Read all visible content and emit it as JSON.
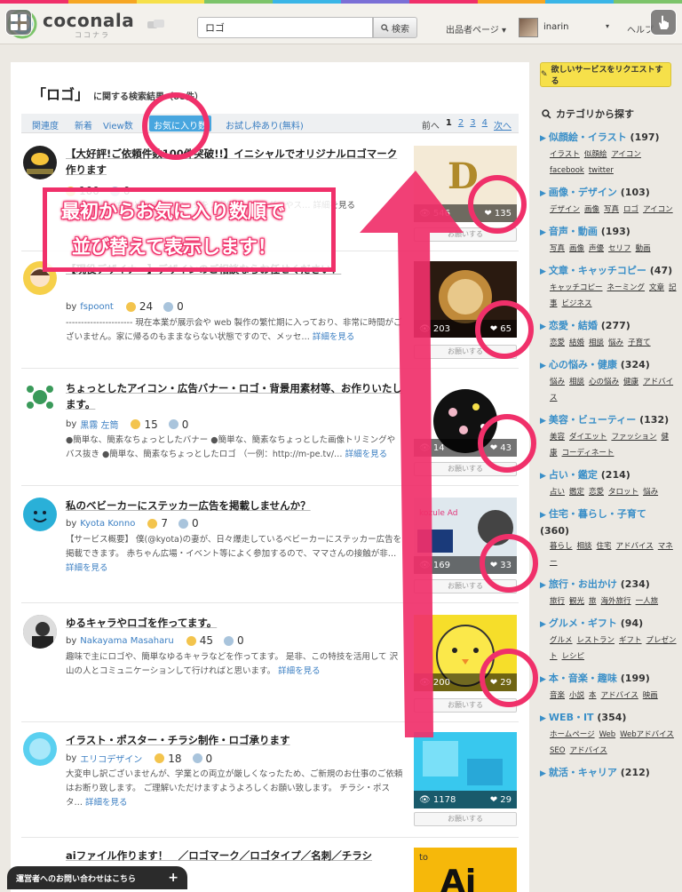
{
  "colors": {
    "accent": "#f0306a",
    "link": "#3a7ec2",
    "category": "#3a8fc8",
    "active_sort": "#48a6df"
  },
  "strip_colors": [
    "#f0306a",
    "#f6a623",
    "#f6e04a",
    "#7cc46a",
    "#3ab5e6",
    "#7a6fd6",
    "#f0306a",
    "#f6a623",
    "#3ab5e6",
    "#7cc46a"
  ],
  "header": {
    "logo": "coconala",
    "logo_sub": "ココナラ",
    "search_value": "ロゴ",
    "search_button": "検索",
    "seller_page": "出品者ページ",
    "user_name": "inarin",
    "help": "ヘルプ"
  },
  "results": {
    "query_title": "「ロゴ」",
    "suffix": "に関する検索結果（68件）"
  },
  "sort": {
    "items": [
      "関連度",
      "新着",
      "View数",
      "お気に入り数",
      "お試し枠あり(無料)"
    ],
    "active": "お気に入り数"
  },
  "pager": {
    "prev": "前へ",
    "pages": [
      "1",
      "2",
      "3",
      "4"
    ],
    "current": "1",
    "next": "次へ"
  },
  "items": [
    {
      "title": "【大好評!ご依頼件数100件突破!!】イニシャルでオリジナルロゴマーク作ります",
      "seller": "",
      "good": "100",
      "bad": "0",
      "desc": "…（王子様／女など）のイ…マークを２案作り…ケーダイやス… 詳細を見る",
      "more": "詳細を見る",
      "views": "546",
      "favs": "135",
      "button": "お願いする"
    },
    {
      "title": "【現役デザイナー】デザインのご相談ならお任せください！",
      "seller": "fspoont",
      "good": "24",
      "bad": "0",
      "desc": "---------------------- 現在本業が展示会や web 製作の繁忙期に入っており、非常に時間がございません。家に帰るのもままならない状態ですので、メッセ…",
      "more": "詳細を見る",
      "views": "203",
      "favs": "65",
      "button": "お願いする"
    },
    {
      "title": "ちょっとしたアイコン・広告バナー・ロゴ・背景用素材等、お作りいたします。",
      "seller": "黒霧 左筒",
      "good": "15",
      "bad": "0",
      "desc": "●簡単な、簡素なちょっとしたバナー ●簡単な、簡素なちょっとした画像トリミングやバス抜き ●簡単な、簡素なちょっとしたロゴ （一例：http://m-pe.tv/…",
      "more": "詳細を見る",
      "views": "14",
      "favs": "43",
      "button": "お願いする"
    },
    {
      "title": "私のベビーカーにステッカー広告を掲載しませんか？",
      "seller": "Kyota Konno",
      "good": "7",
      "bad": "0",
      "desc": "【サービス概要】 僕(@kyota)の妻が、日々爆走しているベビーカーにステッカー広告を掲載できます。 赤ちゃん広場・イベント等によく参加するので、ママさんの接触が非…",
      "more": "詳細を見る",
      "views": "169",
      "favs": "33",
      "button": "お願いする"
    },
    {
      "title": "ゆるキャラやロゴを作ってます。",
      "seller": "Nakayama Masaharu",
      "good": "45",
      "bad": "0",
      "desc": "趣味で主にロゴや、簡単なゆるキャラなどを作ってます。 是非、この特技を活用して 沢山の人とコミュニケーションして行ければと思います。",
      "more": "詳細を見る",
      "views": "200",
      "favs": "29",
      "button": "お願いする"
    },
    {
      "title": "イラスト・ポスター・チラシ制作・ロゴ承ります",
      "seller": "エリコデザイン",
      "good": "18",
      "bad": "0",
      "desc": "大変申し訳ございませんが、学業との両立が厳しくなったため、ご新規のお仕事のご依頼はお断り致します。 ご理解いただけますようよろしくお願い致します。 チラシ・ポスタ…",
      "more": "詳細を見る",
      "views": "1178",
      "favs": "29",
      "button": "お願いする"
    },
    {
      "title": "aiファイル作ります！　／ロゴマーク／ロゴタイプ／名刺／チラシ",
      "seller": "",
      "good": "",
      "bad": "",
      "desc": "",
      "more": "",
      "views": "",
      "favs": "",
      "button": ""
    }
  ],
  "sidebar": {
    "request_button": "欲しいサービスをリクエストする",
    "categories_title": "カテゴリから探す",
    "categories": [
      {
        "name": "似顔絵・イラスト",
        "count": "(197)",
        "subs": [
          "イラスト",
          "似顔絵",
          "アイコン",
          "facebook",
          "twitter"
        ]
      },
      {
        "name": "画像・デザイン",
        "count": "(103)",
        "subs": [
          "デザイン",
          "画像",
          "写真",
          "ロゴ",
          "アイコン"
        ]
      },
      {
        "name": "音声・動画",
        "count": "(193)",
        "subs": [
          "写真",
          "画像",
          "声優",
          "セリフ",
          "動画"
        ]
      },
      {
        "name": "文章・キャッチコピー",
        "count": "(47)",
        "subs": [
          "キャッチコピー",
          "ネーミング",
          "文章",
          "記事",
          "ビジネス"
        ]
      },
      {
        "name": "恋愛・結婚",
        "count": "(277)",
        "subs": [
          "恋愛",
          "結婚",
          "相談",
          "悩み",
          "子育て"
        ]
      },
      {
        "name": "心の悩み・健康",
        "count": "(324)",
        "subs": [
          "悩み",
          "相談",
          "心の悩み",
          "健康",
          "アドバイス"
        ]
      },
      {
        "name": "美容・ビューティー",
        "count": "(132)",
        "subs": [
          "美容",
          "ダイエット",
          "ファッション",
          "健康",
          "コーディネート"
        ]
      },
      {
        "name": "占い・鑑定",
        "count": "(214)",
        "subs": [
          "占い",
          "鑑定",
          "恋愛",
          "タロット",
          "悩み"
        ]
      },
      {
        "name": "住宅・暮らし・子育て",
        "count": "(360)",
        "subs": [
          "暮らし",
          "相談",
          "住宅",
          "アドバイス",
          "マネー"
        ]
      },
      {
        "name": "旅行・お出かけ",
        "count": "(234)",
        "subs": [
          "旅行",
          "観光",
          "旅",
          "海外旅行",
          "一人旅"
        ]
      },
      {
        "name": "グルメ・ギフト",
        "count": "(94)",
        "subs": [
          "グルメ",
          "レストラン",
          "ギフト",
          "プレゼント",
          "レシピ"
        ]
      },
      {
        "name": "本・音楽・趣味",
        "count": "(199)",
        "subs": [
          "音楽",
          "小説",
          "本",
          "アドバイス",
          "映画"
        ]
      },
      {
        "name": "WEB・IT",
        "count": "(354)",
        "subs": [
          "ホームページ",
          "Web",
          "Webアドバイス",
          "SEO",
          "アドバイス"
        ]
      },
      {
        "name": "就活・キャリア",
        "count": "(212)",
        "subs": []
      }
    ]
  },
  "annotation": {
    "line1": "最初からお気に入り数順で",
    "line2": "並び替えて表示します！"
  },
  "contact": {
    "label": "運営者へのお問い合わせはこちら",
    "plus": "+"
  }
}
